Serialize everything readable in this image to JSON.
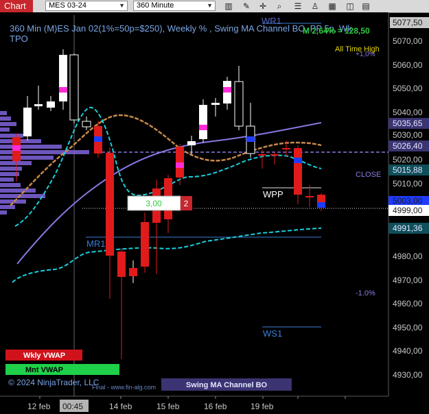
{
  "toolbar": {
    "chart_tab": "Chart",
    "instrument": "MES 03-24",
    "interval": "360 Minute",
    "icons": [
      "bars-icon",
      "pencil-icon",
      "crosshair-icon",
      "zoom-icon",
      "properties-icon",
      "strategy-icon",
      "tile-icon",
      "dom-icon",
      "more-icon"
    ]
  },
  "header": {
    "line1": "360 Min (M)ES Jan 02(1%=50p=$250), Weekly % , Swing MA Channel BO, PP 5p, Wk",
    "line2": "TPO",
    "top_label": "WR1",
    "pct_label": "M 2,64% = 128,50",
    "ath_label": "All Time High",
    "plus_label": "+1,0%"
  },
  "price_axis": {
    "ticks": [
      "5077,50",
      "5070,00",
      "5060,00",
      "5050,00",
      "5040,00",
      "5035,65",
      "5030,00",
      "5026,40",
      "5020,00",
      "5015,88",
      "5010,00",
      "5003,00",
      "4999,00",
      "4991,36",
      "4980,00",
      "4970,00",
      "4960,00",
      "4950,00",
      "4940,00",
      "4930,00"
    ]
  },
  "time_axis": {
    "labels": [
      "12 feb",
      "00:45",
      "14 feb",
      "15 feb",
      "16 feb",
      "19 feb"
    ]
  },
  "annotations": {
    "wpp": "WPP",
    "close": "CLOSE",
    "mr1": "MR1",
    "ws1": "WS1",
    "minus": "-1.0%",
    "position_qty": "3,00",
    "position_count": "2"
  },
  "legend": {
    "weekly_vwap": "Wkly VWAP",
    "monthly_vwap": "Mnt VWAP",
    "copyright": "© 2024 NinjaTrader, LLC",
    "final": "Final - www.fin-alg.com",
    "strategy": "Swing MA Channel BO"
  },
  "colors": {
    "background": "#000000",
    "bull": "#ffffff",
    "bear": "#e11b1b",
    "tpo": "#7a5fd1",
    "channel": "#17d1de",
    "ma_orange": "#c98a4b",
    "ma_purple": "#8878e0",
    "accent_green": "#2ecc40",
    "text": "#c8c8c8",
    "highlight_magenta": "#ff2bd6"
  }
}
